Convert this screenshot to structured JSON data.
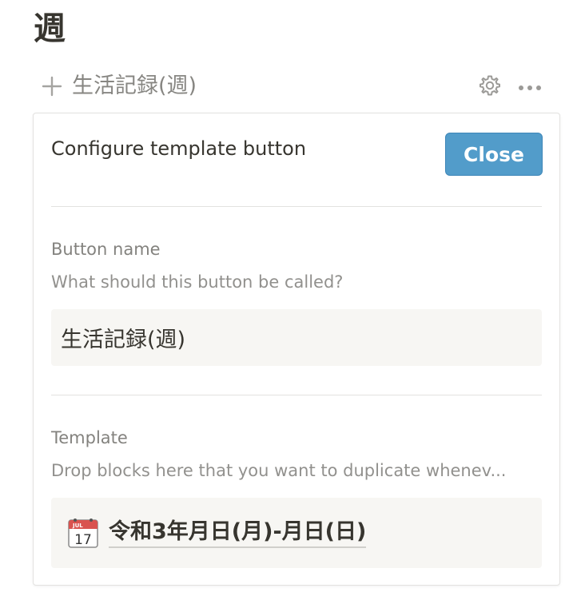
{
  "page": {
    "title": "週"
  },
  "template_button": {
    "label": "生活記録(週)",
    "icon": "plus-icon"
  },
  "row_actions": {
    "settings_icon": "gear-icon",
    "more_icon": "more-icon"
  },
  "config_panel": {
    "title": "Configure template button",
    "close_label": "Close",
    "button_name": {
      "label": "Button name",
      "description": "What should this button be called?",
      "value": "生活記録(週)"
    },
    "template": {
      "label": "Template",
      "description": "Drop blocks here that you want to duplicate whenev...",
      "block": {
        "icon": "calendar-icon",
        "calendar_month": "JUL",
        "calendar_day": "17",
        "title": "令和3年月日(月)-月日(日)"
      }
    }
  },
  "colors": {
    "accent": "#529cca",
    "text": "#37352f",
    "field_bg": "#f7f6f3",
    "divider": "#e3e2e0"
  }
}
